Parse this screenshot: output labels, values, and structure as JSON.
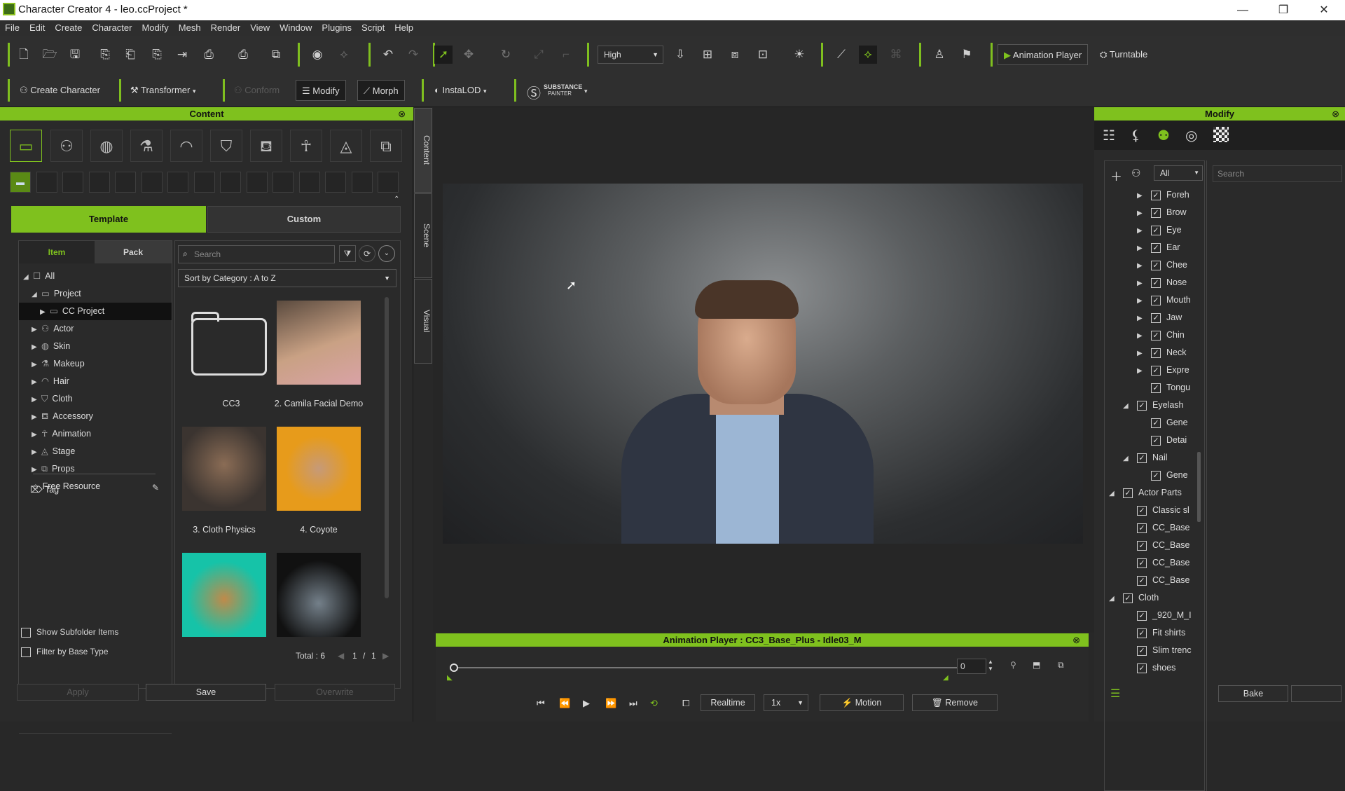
{
  "window": {
    "title": "Character Creator 4 - leo.ccProject *",
    "minimize": "—",
    "maximize": "❐",
    "close": "✕"
  },
  "menu": [
    "File",
    "Edit",
    "Create",
    "Character",
    "Modify",
    "Mesh",
    "Render",
    "View",
    "Window",
    "Plugins",
    "Script",
    "Help"
  ],
  "toolbar": {
    "quality": "High",
    "animation_player": "Animation Player",
    "turntable": "Turntable"
  },
  "toolbar2": {
    "create_character": "Create Character",
    "transformer": "Transformer",
    "conform": "Conform",
    "modify": "Modify",
    "morph": "Morph",
    "instalod": "InstaLOD",
    "substance_line1": "SUBSTANCE",
    "substance_line2": "PAINTER"
  },
  "content": {
    "title": "Content",
    "tabs": {
      "template": "Template",
      "custom": "Custom"
    },
    "subtabs": {
      "item": "Item",
      "pack": "Pack"
    },
    "search_placeholder": "Search",
    "sort": "Sort by Category : A to Z",
    "tree": [
      {
        "label": "All",
        "indent": 0
      },
      {
        "label": "Project",
        "indent": 1
      },
      {
        "label": "CC Project",
        "indent": 2
      },
      {
        "label": "Actor",
        "indent": 1
      },
      {
        "label": "Skin",
        "indent": 1
      },
      {
        "label": "Makeup",
        "indent": 1
      },
      {
        "label": "Hair",
        "indent": 1
      },
      {
        "label": "Cloth",
        "indent": 1
      },
      {
        "label": "Accessory",
        "indent": 1
      },
      {
        "label": "Animation",
        "indent": 1
      },
      {
        "label": "Stage",
        "indent": 1
      },
      {
        "label": "Props",
        "indent": 1
      },
      {
        "label": "Free Resource",
        "indent": 0
      }
    ],
    "tag": "Tag",
    "thumbs": [
      {
        "label": "CC3"
      },
      {
        "label": "2. Camila Facial Demo"
      },
      {
        "label": "3. Cloth Physics"
      },
      {
        "label": "4. Coyote"
      },
      {
        "label": ""
      },
      {
        "label": ""
      }
    ],
    "total": "Total : 6",
    "page": "1",
    "pages": "1",
    "show_subfolder": "Show Subfolder Items",
    "filter_base": "Filter by Base Type",
    "apply": "Apply",
    "save": "Save",
    "overwrite": "Overwrite",
    "side_tabs": [
      "Content",
      "Scene",
      "Visual"
    ]
  },
  "anim": {
    "title": "Animation Player : CC3_Base_Plus - Idle03_M",
    "frame": "0",
    "realtime": "Realtime",
    "speed": "1x",
    "motion": "Motion",
    "remove": "Remove"
  },
  "modify": {
    "title": "Modify",
    "filter": "All",
    "search_placeholder": "Search",
    "bake": "Bake",
    "rows": [
      {
        "label": "Foreh",
        "level": 3,
        "expand": "▶"
      },
      {
        "label": "Brow",
        "level": 3,
        "expand": "▶"
      },
      {
        "label": "Eye",
        "level": 3,
        "expand": "▶"
      },
      {
        "label": "Ear",
        "level": 3,
        "expand": "▶"
      },
      {
        "label": "Chee",
        "level": 3,
        "expand": "▶"
      },
      {
        "label": "Nose",
        "level": 3,
        "expand": "▶"
      },
      {
        "label": "Mouth",
        "level": 3,
        "expand": "▶"
      },
      {
        "label": "Jaw",
        "level": 3,
        "expand": "▶"
      },
      {
        "label": "Chin",
        "level": 3,
        "expand": "▶"
      },
      {
        "label": "Neck",
        "level": 3,
        "expand": "▶"
      },
      {
        "label": "Expre",
        "level": 3,
        "expand": "▶"
      },
      {
        "label": "Tongu",
        "level": 3,
        "expand": ""
      },
      {
        "label": "Eyelash",
        "level": 2,
        "expand": "◢"
      },
      {
        "label": "Gene",
        "level": 3,
        "expand": ""
      },
      {
        "label": "Detai",
        "level": 3,
        "expand": ""
      },
      {
        "label": "Nail",
        "level": 2,
        "expand": "◢"
      },
      {
        "label": "Gene",
        "level": 3,
        "expand": ""
      },
      {
        "label": "Actor Parts",
        "level": 1,
        "expand": "◢"
      },
      {
        "label": "Classic sl",
        "level": 2,
        "expand": ""
      },
      {
        "label": "CC_Base",
        "level": 2,
        "expand": ""
      },
      {
        "label": "CC_Base",
        "level": 2,
        "expand": ""
      },
      {
        "label": "CC_Base",
        "level": 2,
        "expand": ""
      },
      {
        "label": "CC_Base",
        "level": 2,
        "expand": ""
      },
      {
        "label": "Cloth",
        "level": 1,
        "expand": "◢"
      },
      {
        "label": "_920_M_I",
        "level": 2,
        "expand": ""
      },
      {
        "label": "Fit shirts",
        "level": 2,
        "expand": ""
      },
      {
        "label": "Slim trenc",
        "level": 2,
        "expand": ""
      },
      {
        "label": "shoes",
        "level": 2,
        "expand": ""
      }
    ]
  },
  "colors": {
    "accent": "#7fc11e",
    "bg": "#282828"
  }
}
